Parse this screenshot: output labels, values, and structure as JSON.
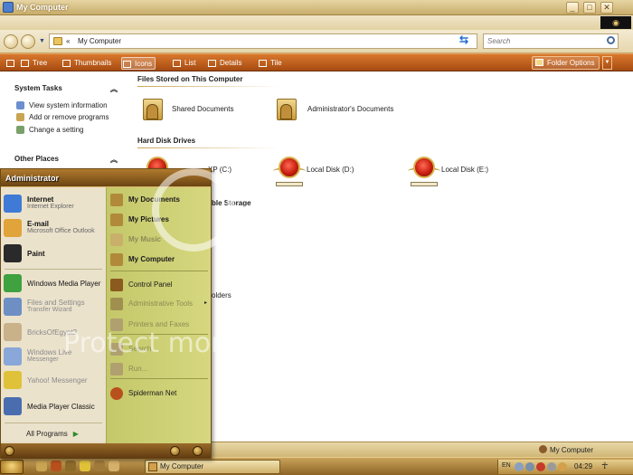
{
  "window": {
    "title": "My Computer",
    "controls": [
      "_",
      "□",
      "✕"
    ]
  },
  "address": {
    "chevron": "«",
    "path": "My Computer",
    "search_placeholder": "Search"
  },
  "toolbar": {
    "items": [
      "Tree",
      "Thumbnails",
      "Icons",
      "List",
      "Details",
      "Tile"
    ],
    "selected": "Icons",
    "folder_options": "Folder Options"
  },
  "taskpane": {
    "system_tasks_title": "System Tasks",
    "collapse": "«",
    "links": [
      "View system information",
      "Add or remove programs",
      "Change a setting"
    ],
    "other_places_title": "Other Places"
  },
  "content": {
    "groups": {
      "files_stored": "Files Stored on This Computer",
      "hard_disk_drives": "Hard Disk Drives",
      "removable_storage_partial": "ble Storage",
      "folders_partial": "olders"
    },
    "folders": [
      "Shared Documents",
      "Administrator's Documents"
    ],
    "drives": [
      {
        "label": "XP (C:)",
        "fill": 0.4
      },
      {
        "label": "Local Disk (D:)",
        "fill": 0.45
      },
      {
        "label": "Local Disk (E:)",
        "fill": 0.3
      }
    ]
  },
  "start_menu": {
    "user": "Administrator",
    "pinned": [
      {
        "name": "Internet",
        "sub": "Internet Explorer",
        "color": "#3f7bd6"
      },
      {
        "name": "E-mail",
        "sub": "Microsoft Office Outlook",
        "color": "#e0a43a"
      },
      {
        "name": "Paint",
        "sub": "",
        "color": "#2a2a2a"
      }
    ],
    "recent": [
      {
        "name": "Windows Media Player",
        "sub": "",
        "color": "#3fa13f"
      },
      {
        "name": "Files and Settings",
        "sub": "Transfer Wizard",
        "color": "#6d8fc4"
      },
      {
        "name": "BricksOfEgypt2",
        "sub": "",
        "color": "#c9b18a"
      },
      {
        "name": "Windows Live",
        "sub": "Messenger",
        "color": "#89a7d8"
      },
      {
        "name": "Yahoo! Messenger",
        "sub": "",
        "color": "#e0c23a"
      },
      {
        "name": "Media Player Classic",
        "sub": "",
        "color": "#4a6db0"
      }
    ],
    "all_programs": "All Programs",
    "right_items": [
      {
        "label": "My Documents",
        "bold": true,
        "dim": false,
        "color": "#b08a3a"
      },
      {
        "label": "My Pictures",
        "bold": true,
        "dim": false,
        "color": "#b08a3a"
      },
      {
        "label": "My Music",
        "bold": true,
        "dim": true,
        "color": "#c9b06a"
      },
      {
        "label": "My Computer",
        "bold": true,
        "dim": false,
        "color": "#b08a3a"
      },
      {
        "label": "Control Panel",
        "bold": false,
        "dim": false,
        "color": "#8a5a1e"
      },
      {
        "label": "Administrative Tools",
        "bold": false,
        "dim": true,
        "color": "#a09050",
        "more": "▸"
      },
      {
        "label": "Printers and Faxes",
        "bold": false,
        "dim": true,
        "color": "#b0a070"
      },
      {
        "label": "Search",
        "bold": false,
        "dim": true,
        "color": "#b0a070"
      },
      {
        "label": "Run...",
        "bold": false,
        "dim": true,
        "color": "#b0a070"
      },
      {
        "label": "Spiderman Net",
        "bold": false,
        "dim": false,
        "color": "#b8501e"
      }
    ]
  },
  "statusbar": {
    "text": "My Computer"
  },
  "taskbar": {
    "task_label": "My Computer",
    "lang": "EN",
    "clock": "04:29"
  },
  "watermark": {
    "brand": "photobucket",
    "tagline": "Protect more of your memories for less!"
  }
}
